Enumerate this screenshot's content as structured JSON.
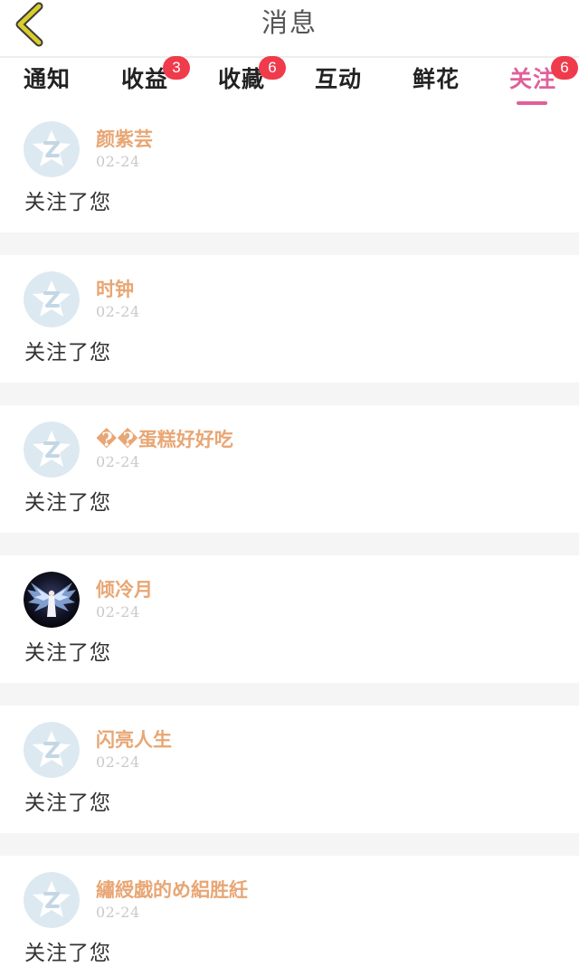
{
  "header": {
    "title": "消息",
    "back_icon": "chevron-left-icon",
    "back_icon_color": "#c7b91a"
  },
  "tabs": [
    {
      "label": "通知",
      "badge": ""
    },
    {
      "label": "收益",
      "badge": "3"
    },
    {
      "label": "收藏",
      "badge": "6"
    },
    {
      "label": "互动",
      "badge": ""
    },
    {
      "label": "鲜花",
      "badge": ""
    },
    {
      "label": "关注",
      "badge": "6",
      "active": true
    }
  ],
  "colors": {
    "active_tab": "#e0609a",
    "badge": "#ef3b4b",
    "username": "#e8a674",
    "date": "#c9c9c9",
    "divider": "#f5f5f5"
  },
  "notifications": [
    {
      "username": "颜紫芸",
      "date": "02-24",
      "message": "关注了您",
      "avatar": "default-avatar-icon"
    },
    {
      "username": "时钟",
      "date": "02-24",
      "message": "关注了您",
      "avatar": "default-avatar-icon"
    },
    {
      "username": "��蛋糕好好吃",
      "date": "02-24",
      "message": "关注了您",
      "avatar": "default-avatar-icon"
    },
    {
      "username": "倾冷月",
      "date": "02-24",
      "message": "关注了您",
      "avatar": "angel-wings-photo"
    },
    {
      "username": "闪亮人生",
      "date": "02-24",
      "message": "关注了您",
      "avatar": "default-avatar-icon"
    },
    {
      "username": "繡綬戯的め絽胜紝",
      "date": "02-24",
      "message": "关注了您",
      "avatar": "default-avatar-icon"
    }
  ]
}
